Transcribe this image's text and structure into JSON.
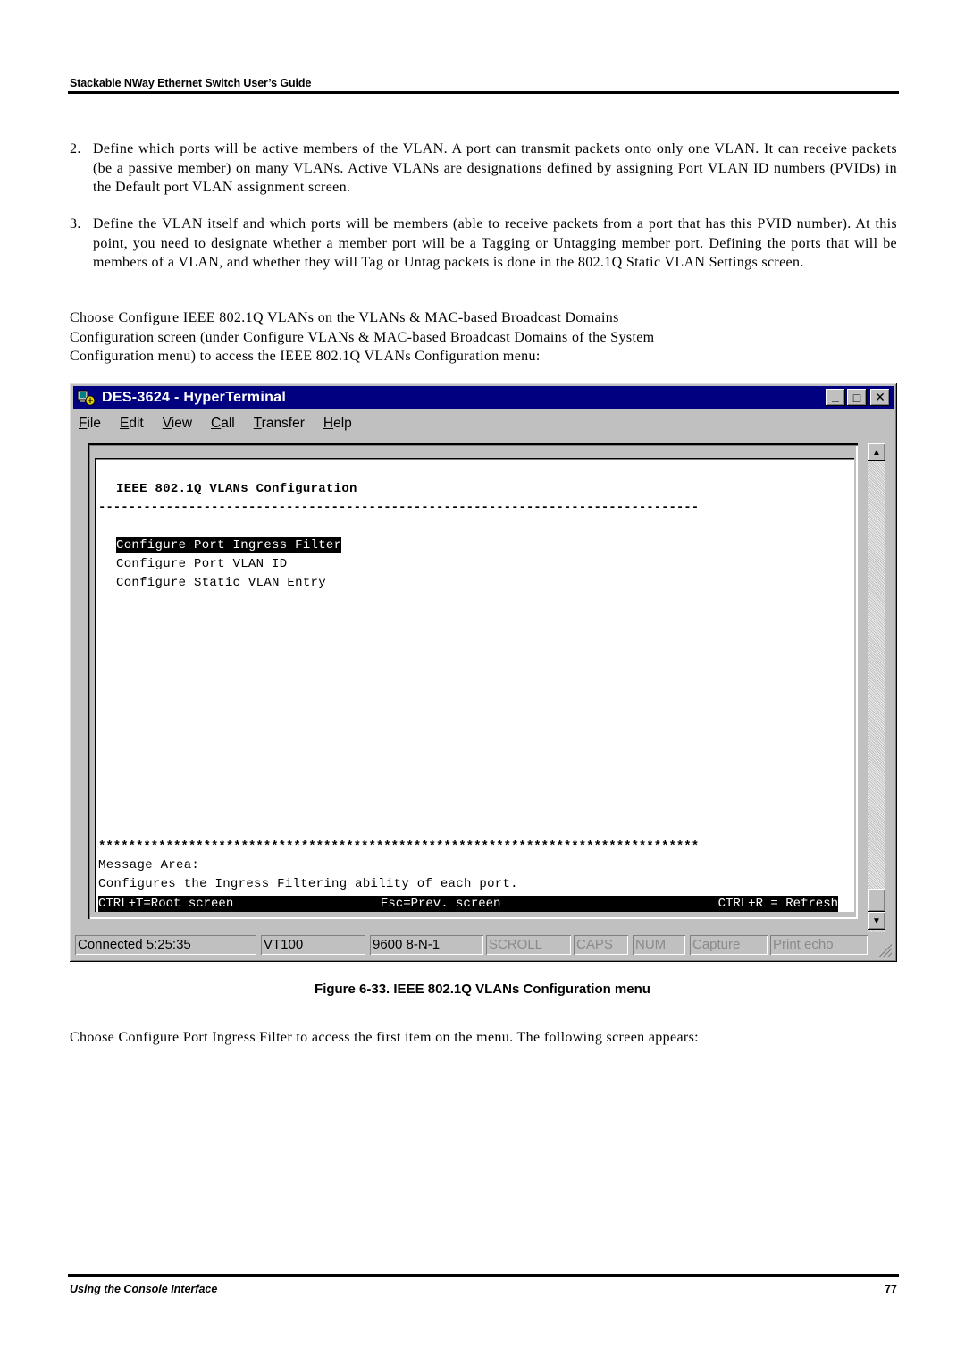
{
  "page": {
    "running_header": "Stackable NWay Ethernet Switch User’s Guide",
    "steps": [
      {
        "number": "2.",
        "text": "Define which ports will be active members of the VLAN. A port can transmit packets onto only one VLAN. It can receive packets (be a passive member) on many VLANs. Active VLANs are designations defined by assigning Port VLAN ID numbers (PVIDs) in the Default port VLAN assignment screen."
      },
      {
        "number": "3.",
        "text": "Define the VLAN itself and which ports will be members (able to receive packets from a port that has this PVID number). At this point, you need to designate whether a member port will be a Tagging or Untagging member port. Defining the ports that will be members of a VLAN, and whether they will Tag or Untag packets is done in the 802.1Q Static VLAN Settings screen."
      }
    ],
    "intro_lines": [
      "Choose Configure IEEE 802.1Q VLANs on the VLANs & MAC-based Broadcast Domains",
      "Configuration screen (under Configure VLANs & MAC-based Broadcast Domains of the System",
      "Configuration menu) to access the IEEE 802.1Q VLANs Configuration menu:"
    ],
    "figure_caption": "Figure 6-33.  IEEE 802.1Q VLANs Configuration menu",
    "after_text": "Choose Configure Port Ingress Filter to access the first item on the menu. The following screen appears:",
    "footer_left": "Using the Console Interface",
    "footer_page": "77"
  },
  "window": {
    "title": "DES-3624 - HyperTerminal",
    "controls": {
      "minimize": "_",
      "maximize": "□",
      "close": "✕"
    },
    "menu": [
      {
        "accel": "F",
        "rest": "ile"
      },
      {
        "accel": "E",
        "rest": "dit"
      },
      {
        "accel": "V",
        "rest": "iew"
      },
      {
        "accel": "C",
        "rest": "all"
      },
      {
        "accel": "T",
        "rest": "ransfer"
      },
      {
        "accel": "H",
        "rest": "elp"
      }
    ],
    "terminal": {
      "heading": "IEEE 802.1Q VLANs Configuration",
      "dash_rule": "--------------------------------------------------------------------------------",
      "menu_items": [
        {
          "label": "Configure Port Ingress Filter",
          "selected": true
        },
        {
          "label": "Configure Port VLAN ID",
          "selected": false
        },
        {
          "label": "Configure Static VLAN Entry",
          "selected": false
        }
      ],
      "star_rule": "********************************************************************************",
      "message_label": "Message Area:",
      "message": "Configures the Ingress Filtering ability of each port.",
      "keys": {
        "root": "CTRL+T=Root screen",
        "prev": "Esc=Prev. screen",
        "refresh": "CTRL+R = Refresh"
      }
    },
    "status": {
      "connection": "Connected 5:25:35",
      "emulation": "VT100",
      "port_settings": "9600 8-N-1",
      "scroll": "SCROLL",
      "caps": "CAPS",
      "num": "NUM",
      "capture": "Capture",
      "print_echo": "Print echo"
    }
  }
}
